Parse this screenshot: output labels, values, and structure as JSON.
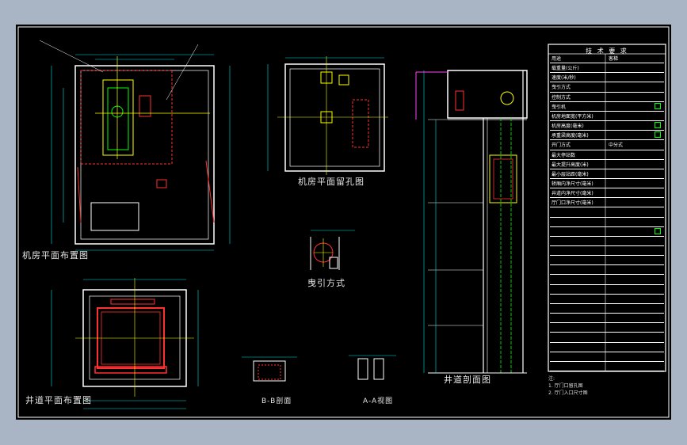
{
  "titles": {
    "machine_room_plan": "机房平面布置图",
    "machine_room_holes": "机房平面留孔图",
    "traction_mode": "曳引方式",
    "hoistway_plan": "井道平面布置图",
    "hoistway_section": "井道剖面图",
    "section_bb": "B-B剖面",
    "view_aa": "A-A视图"
  },
  "spec_table": {
    "title": "技 术 要 求",
    "rows": [
      {
        "k": "用途",
        "v": "客梯",
        "tick": false
      },
      {
        "k": "载重量(公斤)",
        "v": "",
        "tick": false
      },
      {
        "k": "速度(米/秒)",
        "v": "",
        "tick": false
      },
      {
        "k": "曳引方式",
        "v": "",
        "tick": false
      },
      {
        "k": "控制方式",
        "v": "",
        "tick": false
      },
      {
        "k": "曳引机",
        "v": "",
        "tick": true
      },
      {
        "k": "机房地面宽(平方米)",
        "v": "",
        "tick": false
      },
      {
        "k": "机房高度(毫米)",
        "v": "",
        "tick": true
      },
      {
        "k": "承重梁高度(毫米)",
        "v": "",
        "tick": true
      },
      {
        "k": "开门方式",
        "v": "中分式",
        "tick": false
      },
      {
        "k": "最大停站数",
        "v": "",
        "tick": false
      },
      {
        "k": "最大提升高度(米)",
        "v": "",
        "tick": false
      },
      {
        "k": "最小层站距(毫米)",
        "v": "",
        "tick": false
      },
      {
        "k": "轿厢内净尺寸(毫米)",
        "v": "",
        "tick": false
      },
      {
        "k": "井道内净尺寸(毫米)",
        "v": "",
        "tick": false
      },
      {
        "k": "厅门口净尺寸(毫米)",
        "v": "",
        "tick": false
      },
      {
        "k": "",
        "v": "",
        "tick": false
      },
      {
        "k": "",
        "v": "",
        "tick": false
      },
      {
        "k": "",
        "v": "",
        "tick": true
      },
      {
        "k": "",
        "v": "",
        "tick": false
      },
      {
        "k": "",
        "v": "",
        "tick": false
      },
      {
        "k": "",
        "v": "",
        "tick": false
      },
      {
        "k": "",
        "v": "",
        "tick": false
      },
      {
        "k": "",
        "v": "",
        "tick": false
      },
      {
        "k": "",
        "v": "",
        "tick": false
      },
      {
        "k": "",
        "v": "",
        "tick": false
      },
      {
        "k": "",
        "v": "",
        "tick": false
      },
      {
        "k": "",
        "v": "",
        "tick": false
      },
      {
        "k": "",
        "v": "",
        "tick": false
      },
      {
        "k": "",
        "v": "",
        "tick": false
      },
      {
        "k": "",
        "v": "",
        "tick": false
      },
      {
        "k": "",
        "v": "",
        "tick": false
      },
      {
        "k": "",
        "v": "",
        "tick": false
      }
    ]
  },
  "notes": {
    "heading": "注:",
    "line1": "1. 厅门口留孔图",
    "line2": "2. 厅门入口尺寸图"
  },
  "colors": {
    "sheet_bg": "#000000",
    "frame": "#ffffff",
    "annotation": "#00e0e0",
    "hidden": "#ff3030",
    "accent": "#ffff00",
    "rail": "#00ff00",
    "magenta": "#ff40ff"
  }
}
